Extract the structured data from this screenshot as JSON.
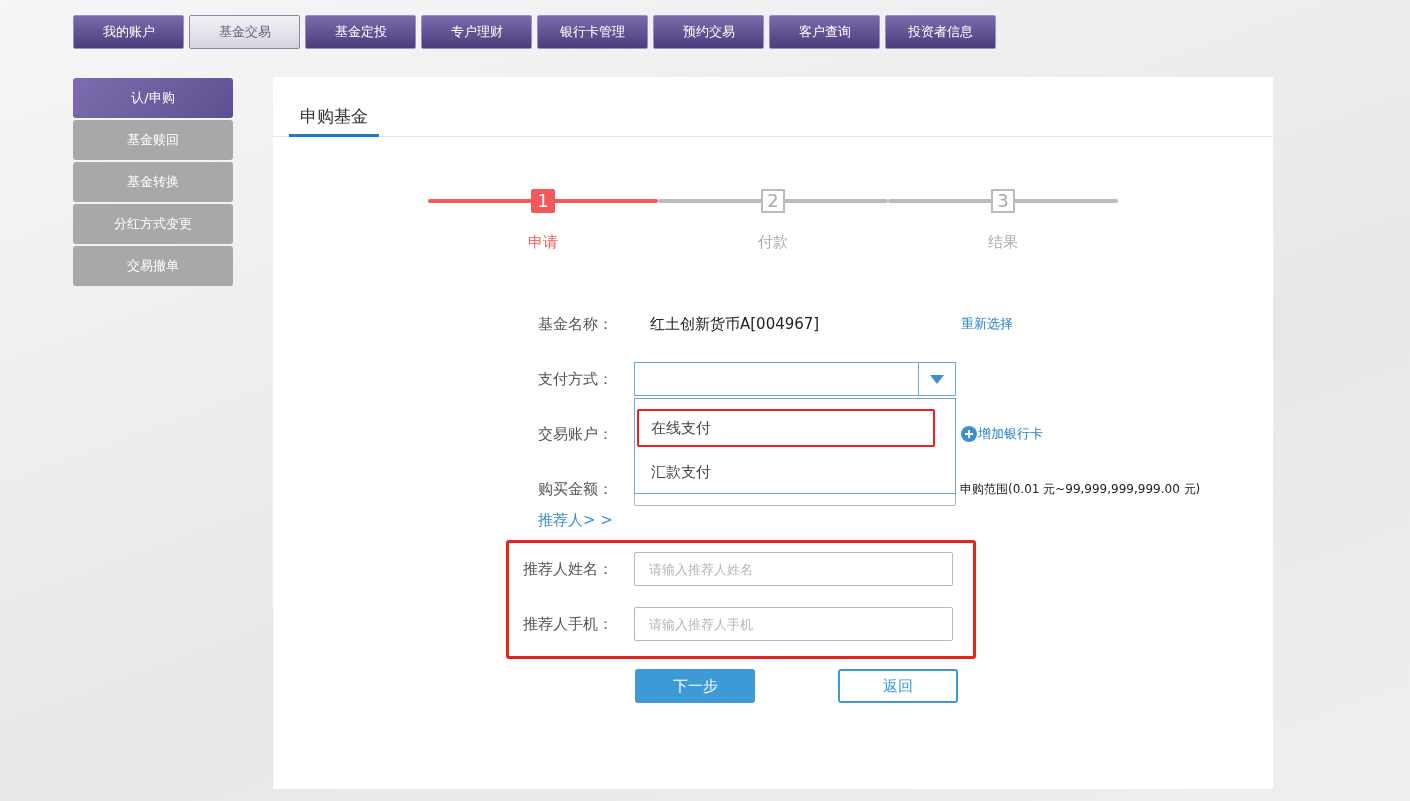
{
  "top_nav": [
    {
      "label": "我的账户",
      "selected": false
    },
    {
      "label": "基金交易",
      "selected": true
    },
    {
      "label": "基金定投",
      "selected": false
    },
    {
      "label": "专户理财",
      "selected": false
    },
    {
      "label": "银行卡管理",
      "selected": false
    },
    {
      "label": "预约交易",
      "selected": false
    },
    {
      "label": "客户查询",
      "selected": false
    },
    {
      "label": "投资者信息",
      "selected": false
    }
  ],
  "sidebar": [
    {
      "label": "认/申购",
      "selected": true
    },
    {
      "label": "基金赎回",
      "selected": false
    },
    {
      "label": "基金转换",
      "selected": false
    },
    {
      "label": "分红方式变更",
      "selected": false
    },
    {
      "label": "交易撤单",
      "selected": false
    }
  ],
  "panel": {
    "title": "申购基金"
  },
  "steps": [
    {
      "number": "1",
      "label": "申请",
      "active": true
    },
    {
      "number": "2",
      "label": "付款",
      "active": false
    },
    {
      "number": "3",
      "label": "结果",
      "active": false
    }
  ],
  "form": {
    "fund_name": {
      "label": "基金名称：",
      "value": "红土创新货币A[004967]",
      "link": "重新选择"
    },
    "payment": {
      "label": "支付方式：",
      "expanded": true,
      "options": [
        {
          "label": "在线支付",
          "highlighted": true
        },
        {
          "label": "汇款支付",
          "highlighted": false
        }
      ]
    },
    "account": {
      "label": "交易账户：",
      "link": "增加银行卡"
    },
    "amount": {
      "label": "购买金额：",
      "hint": "申购范围(0.01 元~99,999,999,999.00 元)"
    },
    "referrer_toggle": "推荐人> >",
    "referrer": {
      "highlighted": true,
      "fields": [
        {
          "label": "推荐人姓名：",
          "placeholder": "请输入推荐人姓名"
        },
        {
          "label": "推荐人手机：",
          "placeholder": "请输入推荐人手机"
        }
      ]
    }
  },
  "buttons": [
    {
      "label": "下一步",
      "kind": "primary"
    },
    {
      "label": "返回",
      "kind": "secondary"
    }
  ]
}
